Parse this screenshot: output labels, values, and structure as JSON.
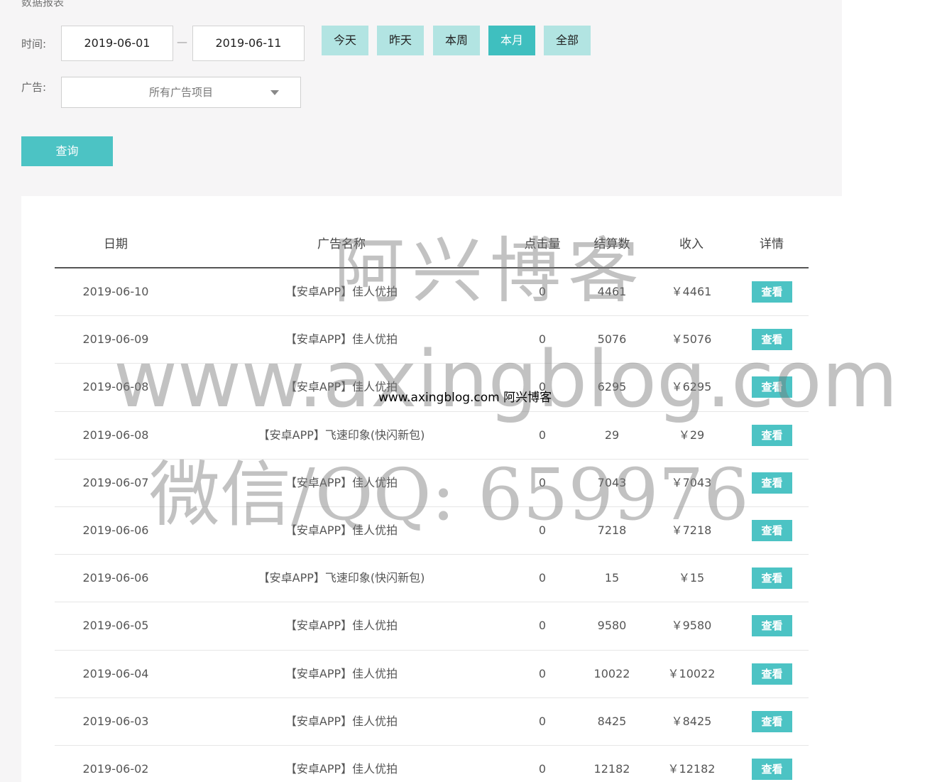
{
  "page": {
    "heading": "数据报表"
  },
  "filters": {
    "time_label": "时间:",
    "date_from": "2019-06-01",
    "date_sep": "—",
    "date_to": "2019-06-11",
    "range_buttons": [
      {
        "label": "今天",
        "active": false
      },
      {
        "label": "昨天",
        "active": false
      },
      {
        "label": "本周",
        "active": false
      },
      {
        "label": "本月",
        "active": true
      },
      {
        "label": "全部",
        "active": false
      }
    ],
    "ad_label": "广告:",
    "ad_select_value": "所有广告项目",
    "query_label": "查询"
  },
  "table": {
    "columns": [
      "日期",
      "广告名称",
      "点击量",
      "结算数",
      "收入",
      "详情"
    ],
    "rows": [
      {
        "date": "2019-06-10",
        "name": "【安卓APP】佳人优拍",
        "clicks": "0",
        "settle": "4461",
        "income": "￥4461",
        "action": "查看"
      },
      {
        "date": "2019-06-09",
        "name": "【安卓APP】佳人优拍",
        "clicks": "0",
        "settle": "5076",
        "income": "￥5076",
        "action": "查看"
      },
      {
        "date": "2019-06-08",
        "name": "【安卓APP】佳人优拍",
        "clicks": "0",
        "settle": "6295",
        "income": "￥6295",
        "action": "查看"
      },
      {
        "date": "2019-06-08",
        "name": "【安卓APP】飞速印象(快闪新包)",
        "clicks": "0",
        "settle": "29",
        "income": "￥29",
        "action": "查看"
      },
      {
        "date": "2019-06-07",
        "name": "【安卓APP】佳人优拍",
        "clicks": "0",
        "settle": "7043",
        "income": "￥7043",
        "action": "查看"
      },
      {
        "date": "2019-06-06",
        "name": "【安卓APP】佳人优拍",
        "clicks": "0",
        "settle": "7218",
        "income": "￥7218",
        "action": "查看"
      },
      {
        "date": "2019-06-06",
        "name": "【安卓APP】飞速印象(快闪新包)",
        "clicks": "0",
        "settle": "15",
        "income": "￥15",
        "action": "查看"
      },
      {
        "date": "2019-06-05",
        "name": "【安卓APP】佳人优拍",
        "clicks": "0",
        "settle": "9580",
        "income": "￥9580",
        "action": "查看"
      },
      {
        "date": "2019-06-04",
        "name": "【安卓APP】佳人优拍",
        "clicks": "0",
        "settle": "10022",
        "income": "￥10022",
        "action": "查看"
      },
      {
        "date": "2019-06-03",
        "name": "【安卓APP】佳人优拍",
        "clicks": "0",
        "settle": "8425",
        "income": "￥8425",
        "action": "查看"
      },
      {
        "date": "2019-06-02",
        "name": "【安卓APP】佳人优拍",
        "clicks": "0",
        "settle": "12182",
        "income": "￥12182",
        "action": "查看"
      }
    ]
  },
  "watermark": {
    "line1": "阿兴博客",
    "line2": "www.axingblog.com",
    "line3": "微信/QQ: 659976",
    "small": "www.axingblog.com 阿兴博客"
  }
}
